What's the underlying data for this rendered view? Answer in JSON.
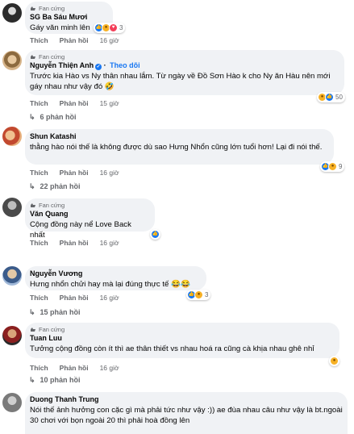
{
  "comments": [
    {
      "badge": "Fan cứng",
      "name": "SG Ba Sáu Mươi",
      "text": "Gáy văn minh lên",
      "like": "Thích",
      "reply": "Phản hồi",
      "time": "16 giờ",
      "reaction_count": "3",
      "reactions": [
        "like",
        "haha",
        "love"
      ],
      "avatar_color": "#2b2b2b"
    },
    {
      "badge": "Fan cứng",
      "name": "Nguyễn Thiện Anh",
      "follow": "Theo dõi",
      "verified": true,
      "text": "Trước kia Hào vs Ny thân nhau lắm. Từ ngày về Đồ Sơn Hào k cho Ny ăn Hàu nên mới gáy nhau như vậy đó 🤣",
      "like": "Thích",
      "reply": "Phản hồi",
      "time": "15 giờ",
      "reaction_count": "50",
      "reactions": [
        "haha",
        "like"
      ],
      "replies": "6 phản hồi",
      "avatar_color": "#c9a37a"
    },
    {
      "name": "Shun Katashi",
      "text": "thằng hào nói thế là không được dù sao Hưng Nhổn cũng lớn tuổi hơn! Lại đi nói thế.",
      "like": "Thích",
      "reply": "Phản hồi",
      "time": "16 giờ",
      "reaction_count": "9",
      "reactions": [
        "like",
        "haha"
      ],
      "replies": "22 phản hồi",
      "avatar_color": "#d08a4c"
    },
    {
      "badge": "Fan cứng",
      "name": "Văn Quang",
      "text": "Cộng đồng này nể Love Back nhất",
      "like": "Thích",
      "reply": "Phản hồi",
      "time": "16 giờ",
      "reactions": [
        "like"
      ],
      "avatar_color": "#5a5a5a"
    },
    {
      "name": "Nguyễn Vương",
      "text": "Hưng nhổn chửi hay mà lại đúng thực tế 😂😂",
      "like": "Thích",
      "reply": "Phản hồi",
      "time": "16 giờ",
      "reaction_count": "3",
      "reactions": [
        "like",
        "haha"
      ],
      "replies": "15 phản hồi",
      "avatar_color": "#3b5b8a"
    },
    {
      "badge": "Fan cứng",
      "name": "Tuan Luu",
      "text": "Tưởng cộng đồng còn ít thì ae thân thiết vs nhau hoá ra cũng cà khịa nhau ghê nhỉ",
      "like": "Thích",
      "reply": "Phản hồi",
      "time": "16 giờ",
      "reactions": [
        "haha"
      ],
      "replies": "10 phản hồi",
      "avatar_color": "#8a1f1f"
    },
    {
      "name": "Duong Thanh Trung",
      "text": "Nói thế ảnh hưởng con cặc gì mà phải tức như vậy :)) ae đùa nhau câu như vậy là bt.ngoài 30 chơi với bọn ngoài 20 thì phải hoà đồng lên",
      "avatar_color": "#7a7a7a"
    }
  ]
}
